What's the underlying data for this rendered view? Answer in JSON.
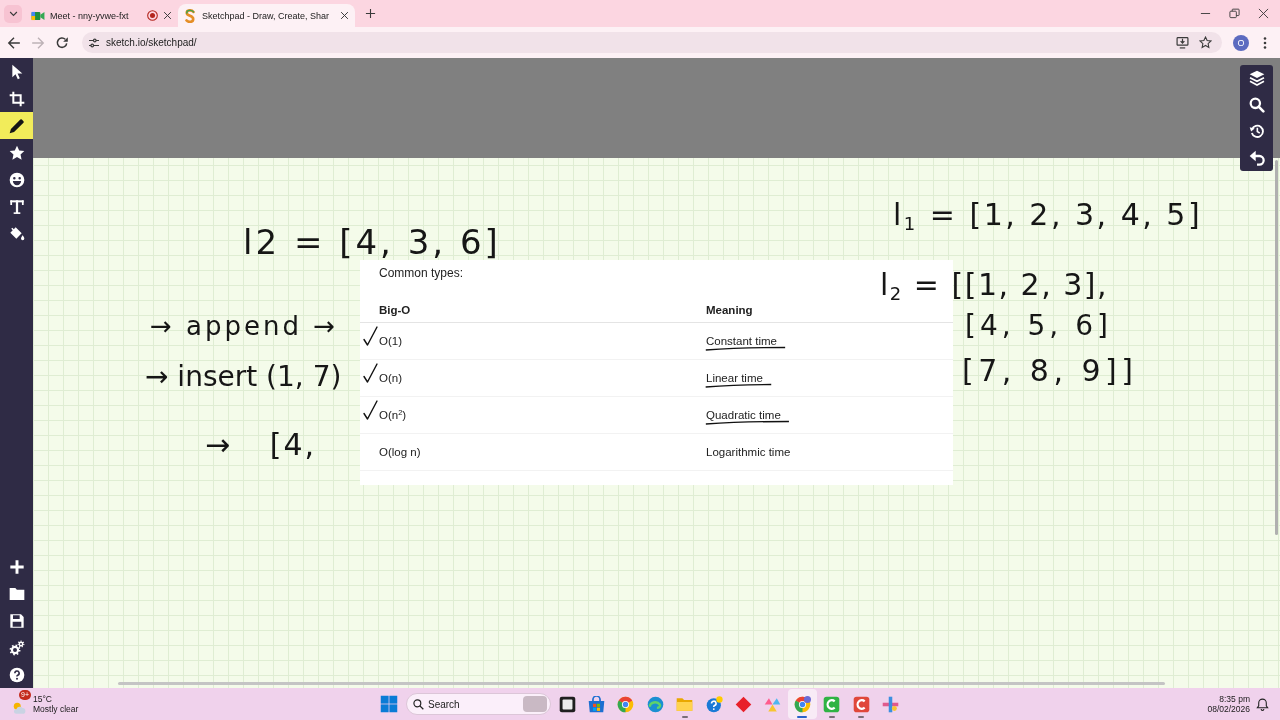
{
  "browser": {
    "tabs": [
      {
        "kind": "video",
        "title": "Meet - nny-yvwe-fxt",
        "recording": true,
        "selected": false
      },
      {
        "kind": "drawing",
        "title": "Sketchpad - Draw, Create, Shar",
        "recording": false,
        "selected": true
      }
    ],
    "forward": {
      "disabled": true
    },
    "address": "sketch.io/sketchpad/",
    "profile": "O"
  },
  "toolbar": {
    "tools": [
      {
        "kind": "select",
        "selected": false
      },
      {
        "kind": "crop",
        "selected": false
      },
      {
        "kind": "pencil",
        "selected": true
      },
      {
        "kind": "stamp",
        "selected": false
      },
      {
        "kind": "emoji",
        "selected": false
      },
      {
        "kind": "text",
        "selected": false
      },
      {
        "kind": "fill",
        "selected": false
      }
    ],
    "actions": [
      {
        "kind": "add"
      },
      {
        "kind": "open"
      },
      {
        "kind": "save"
      },
      {
        "kind": "settings"
      },
      {
        "kind": "help"
      }
    ]
  },
  "view_tools": [
    {
      "kind": "layers"
    },
    {
      "kind": "zoom"
    },
    {
      "kind": "history"
    },
    {
      "kind": "undo"
    }
  ],
  "canvas": {
    "notes": [
      "l$_{1}$ = [1, 2, 3, 4, 5]",
      "l2 = [4, 3, 6]",
      "l$_{2}$ = [[1, 2, 3],",
      "→ append →",
      "[4, 5, 6]",
      "→ insert (1, 7)",
      "[7, 8, 9]]",
      "→ [4,"
    ],
    "table": {
      "caption": "Common types:",
      "columns": [
        "Big-O",
        "Meaning"
      ],
      "rows": [
        {
          "big_o": "O(1)",
          "meaning": "Constant time",
          "checked": true,
          "underlined": true
        },
        {
          "big_o": "O(n)",
          "meaning": "Linear time",
          "checked": true,
          "underlined": true
        },
        {
          "big_o": "O(n$^{2}$)",
          "meaning": "Quadratic time",
          "checked": true,
          "underlined": true
        },
        {
          "big_o": "O(log n)",
          "meaning": "Logarithmic time",
          "checked": false,
          "underlined": false
        }
      ]
    }
  },
  "taskbar": {
    "weather": {
      "badge": "9+",
      "temperature": "15°C",
      "condition": "Mostly clear"
    },
    "search": {
      "placeholder": "Search"
    },
    "apps": [
      {
        "kind": "taskview",
        "running": false,
        "selected": false
      },
      {
        "kind": "store",
        "running": false,
        "selected": false
      },
      {
        "kind": "browser",
        "running": false,
        "selected": false
      },
      {
        "kind": "swirl",
        "running": false,
        "selected": false
      },
      {
        "kind": "folder",
        "running": true,
        "selected": false
      },
      {
        "kind": "help",
        "running": false,
        "selected": false
      },
      {
        "kind": "diamond",
        "running": false,
        "selected": false
      },
      {
        "kind": "triangles",
        "running": false,
        "selected": false
      },
      {
        "kind": "profilebrowser",
        "running": true,
        "selected": true
      },
      {
        "kind": "greenc",
        "running": true,
        "selected": false
      },
      {
        "kind": "redc",
        "running": true,
        "selected": false
      },
      {
        "kind": "snip",
        "running": false,
        "selected": false
      }
    ],
    "time": "8:35 pm",
    "date": "08/02/2026"
  }
}
